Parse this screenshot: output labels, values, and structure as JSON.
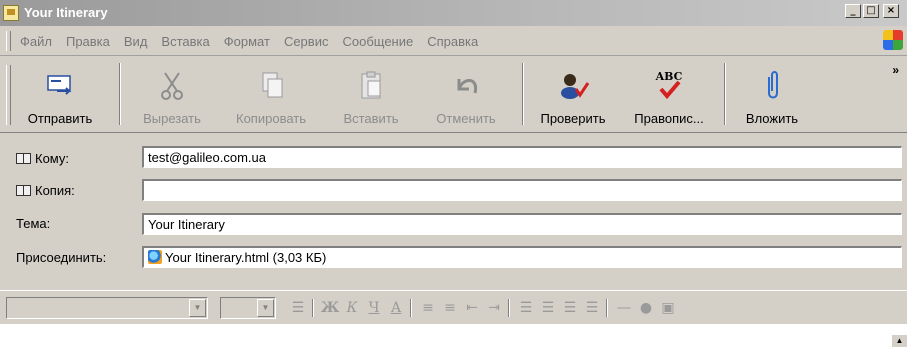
{
  "window": {
    "title": "Your Itinerary",
    "buttons": {
      "minimize": "_",
      "maximize": "□",
      "close": "×"
    }
  },
  "menu": {
    "items": [
      "Файл",
      "Правка",
      "Вид",
      "Вставка",
      "Формат",
      "Сервис",
      "Сообщение",
      "Справка"
    ]
  },
  "toolbar": {
    "send": "Отправить",
    "cut": "Вырезать",
    "copy": "Копировать",
    "paste": "Вставить",
    "undo": "Отменить",
    "check": "Проверить",
    "spelling": "Правопис...",
    "attach": "Вложить",
    "spell_abc": "ABC",
    "more": "»"
  },
  "fields": {
    "to_label": "Кому:",
    "to_value": "test@galileo.com.ua",
    "cc_label": "Копия:",
    "cc_value": "",
    "subject_label": "Тема:",
    "subject_value": "Your Itinerary",
    "attach_label": "Присоединить:",
    "attach_value": "Your Itinerary.html (3,03 КБ)"
  },
  "format_toolbar": {
    "bold": "Ж",
    "italic": "К",
    "underline": "Ч",
    "font_color": "А"
  },
  "colors": {
    "titlebar_text": "#ffffff",
    "chrome": "#d4d0c8",
    "disabled_text": "#8c8c8c"
  }
}
